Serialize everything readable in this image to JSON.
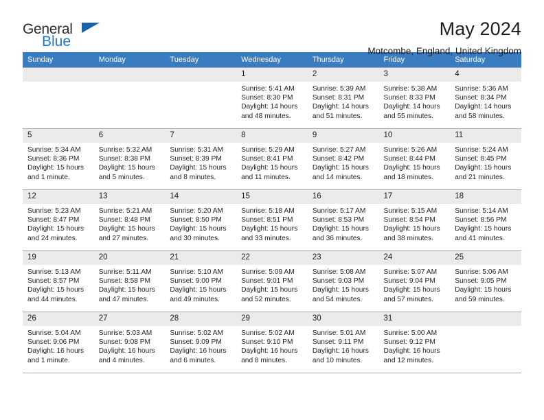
{
  "brand": {
    "line1": "General",
    "line2": "Blue",
    "triangle_color": "#1862ad",
    "blue_color": "#1f77c4"
  },
  "header": {
    "title": "May 2024",
    "subtitle": "Motcombe, England, United Kingdom"
  },
  "theme": {
    "header_row_bg": "#3a7cc0",
    "daynum_bg": "#ebebeb",
    "grid_line": "#9aa7b4"
  },
  "weekdays": [
    "Sunday",
    "Monday",
    "Tuesday",
    "Wednesday",
    "Thursday",
    "Friday",
    "Saturday"
  ],
  "labels": {
    "sunrise_prefix": "Sunrise:",
    "sunset_prefix": "Sunset:",
    "daylight_prefix": "Daylight:"
  },
  "weeks": [
    [
      {
        "day": "",
        "lines": []
      },
      {
        "day": "",
        "lines": []
      },
      {
        "day": "",
        "lines": []
      },
      {
        "day": "1",
        "lines": [
          "Sunrise: 5:41 AM",
          "Sunset: 8:30 PM",
          "Daylight: 14 hours",
          "and 48 minutes."
        ]
      },
      {
        "day": "2",
        "lines": [
          "Sunrise: 5:39 AM",
          "Sunset: 8:31 PM",
          "Daylight: 14 hours",
          "and 51 minutes."
        ]
      },
      {
        "day": "3",
        "lines": [
          "Sunrise: 5:38 AM",
          "Sunset: 8:33 PM",
          "Daylight: 14 hours",
          "and 55 minutes."
        ]
      },
      {
        "day": "4",
        "lines": [
          "Sunrise: 5:36 AM",
          "Sunset: 8:34 PM",
          "Daylight: 14 hours",
          "and 58 minutes."
        ]
      }
    ],
    [
      {
        "day": "5",
        "lines": [
          "Sunrise: 5:34 AM",
          "Sunset: 8:36 PM",
          "Daylight: 15 hours",
          "and 1 minute."
        ]
      },
      {
        "day": "6",
        "lines": [
          "Sunrise: 5:32 AM",
          "Sunset: 8:38 PM",
          "Daylight: 15 hours",
          "and 5 minutes."
        ]
      },
      {
        "day": "7",
        "lines": [
          "Sunrise: 5:31 AM",
          "Sunset: 8:39 PM",
          "Daylight: 15 hours",
          "and 8 minutes."
        ]
      },
      {
        "day": "8",
        "lines": [
          "Sunrise: 5:29 AM",
          "Sunset: 8:41 PM",
          "Daylight: 15 hours",
          "and 11 minutes."
        ]
      },
      {
        "day": "9",
        "lines": [
          "Sunrise: 5:27 AM",
          "Sunset: 8:42 PM",
          "Daylight: 15 hours",
          "and 14 minutes."
        ]
      },
      {
        "day": "10",
        "lines": [
          "Sunrise: 5:26 AM",
          "Sunset: 8:44 PM",
          "Daylight: 15 hours",
          "and 18 minutes."
        ]
      },
      {
        "day": "11",
        "lines": [
          "Sunrise: 5:24 AM",
          "Sunset: 8:45 PM",
          "Daylight: 15 hours",
          "and 21 minutes."
        ]
      }
    ],
    [
      {
        "day": "12",
        "lines": [
          "Sunrise: 5:23 AM",
          "Sunset: 8:47 PM",
          "Daylight: 15 hours",
          "and 24 minutes."
        ]
      },
      {
        "day": "13",
        "lines": [
          "Sunrise: 5:21 AM",
          "Sunset: 8:48 PM",
          "Daylight: 15 hours",
          "and 27 minutes."
        ]
      },
      {
        "day": "14",
        "lines": [
          "Sunrise: 5:20 AM",
          "Sunset: 8:50 PM",
          "Daylight: 15 hours",
          "and 30 minutes."
        ]
      },
      {
        "day": "15",
        "lines": [
          "Sunrise: 5:18 AM",
          "Sunset: 8:51 PM",
          "Daylight: 15 hours",
          "and 33 minutes."
        ]
      },
      {
        "day": "16",
        "lines": [
          "Sunrise: 5:17 AM",
          "Sunset: 8:53 PM",
          "Daylight: 15 hours",
          "and 36 minutes."
        ]
      },
      {
        "day": "17",
        "lines": [
          "Sunrise: 5:15 AM",
          "Sunset: 8:54 PM",
          "Daylight: 15 hours",
          "and 38 minutes."
        ]
      },
      {
        "day": "18",
        "lines": [
          "Sunrise: 5:14 AM",
          "Sunset: 8:56 PM",
          "Daylight: 15 hours",
          "and 41 minutes."
        ]
      }
    ],
    [
      {
        "day": "19",
        "lines": [
          "Sunrise: 5:13 AM",
          "Sunset: 8:57 PM",
          "Daylight: 15 hours",
          "and 44 minutes."
        ]
      },
      {
        "day": "20",
        "lines": [
          "Sunrise: 5:11 AM",
          "Sunset: 8:58 PM",
          "Daylight: 15 hours",
          "and 47 minutes."
        ]
      },
      {
        "day": "21",
        "lines": [
          "Sunrise: 5:10 AM",
          "Sunset: 9:00 PM",
          "Daylight: 15 hours",
          "and 49 minutes."
        ]
      },
      {
        "day": "22",
        "lines": [
          "Sunrise: 5:09 AM",
          "Sunset: 9:01 PM",
          "Daylight: 15 hours",
          "and 52 minutes."
        ]
      },
      {
        "day": "23",
        "lines": [
          "Sunrise: 5:08 AM",
          "Sunset: 9:03 PM",
          "Daylight: 15 hours",
          "and 54 minutes."
        ]
      },
      {
        "day": "24",
        "lines": [
          "Sunrise: 5:07 AM",
          "Sunset: 9:04 PM",
          "Daylight: 15 hours",
          "and 57 minutes."
        ]
      },
      {
        "day": "25",
        "lines": [
          "Sunrise: 5:06 AM",
          "Sunset: 9:05 PM",
          "Daylight: 15 hours",
          "and 59 minutes."
        ]
      }
    ],
    [
      {
        "day": "26",
        "lines": [
          "Sunrise: 5:04 AM",
          "Sunset: 9:06 PM",
          "Daylight: 16 hours",
          "and 1 minute."
        ]
      },
      {
        "day": "27",
        "lines": [
          "Sunrise: 5:03 AM",
          "Sunset: 9:08 PM",
          "Daylight: 16 hours",
          "and 4 minutes."
        ]
      },
      {
        "day": "28",
        "lines": [
          "Sunrise: 5:02 AM",
          "Sunset: 9:09 PM",
          "Daylight: 16 hours",
          "and 6 minutes."
        ]
      },
      {
        "day": "29",
        "lines": [
          "Sunrise: 5:02 AM",
          "Sunset: 9:10 PM",
          "Daylight: 16 hours",
          "and 8 minutes."
        ]
      },
      {
        "day": "30",
        "lines": [
          "Sunrise: 5:01 AM",
          "Sunset: 9:11 PM",
          "Daylight: 16 hours",
          "and 10 minutes."
        ]
      },
      {
        "day": "31",
        "lines": [
          "Sunrise: 5:00 AM",
          "Sunset: 9:12 PM",
          "Daylight: 16 hours",
          "and 12 minutes."
        ]
      },
      {
        "day": "",
        "lines": []
      }
    ]
  ]
}
